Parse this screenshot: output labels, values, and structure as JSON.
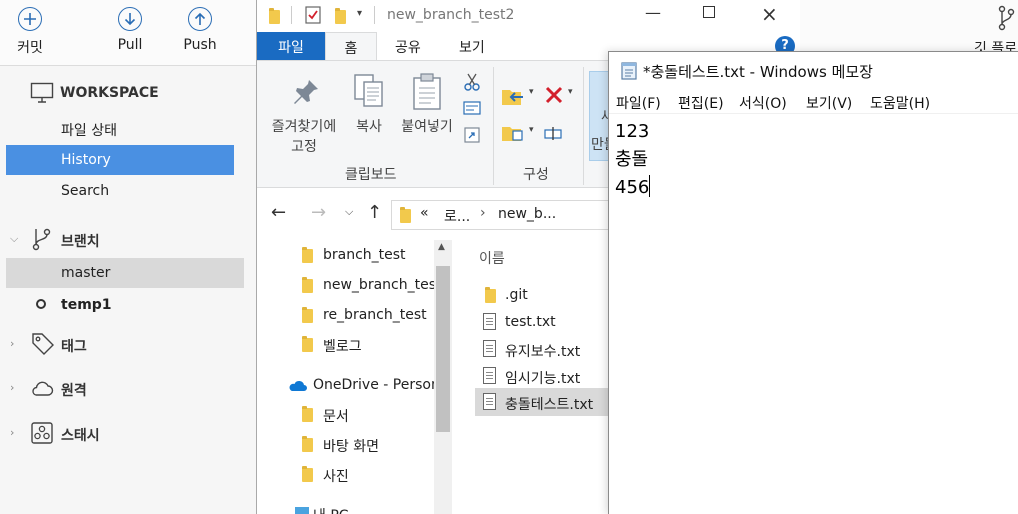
{
  "sourcetree": {
    "toolbar": {
      "commit": "커밋",
      "pull": "Pull",
      "push": "Push",
      "git_flow": "깃 플로"
    },
    "sidebar": {
      "workspace": "WORKSPACE",
      "file_status": "파일 상태",
      "history": "History",
      "search": "Search",
      "branches": "브랜치",
      "branch_master": "master",
      "branch_temp1": "temp1",
      "tags": "태그",
      "remotes": "원격",
      "stashes": "스태시"
    },
    "colors": {
      "selection": "#4a90e2",
      "icon_blue": "#2a6db5"
    }
  },
  "explorer": {
    "title": "new_branch_test2",
    "tabs": {
      "file": "파일",
      "home": "홈",
      "share": "공유",
      "view": "보기"
    },
    "ribbon": {
      "pin_quick_access_1": "즐겨찾기에",
      "pin_quick_access_2": "고정",
      "copy": "복사",
      "paste": "붙여넣기",
      "group_clipboard": "클립보드",
      "group_organize": "구성",
      "new_fragment_1": "새",
      "new_fragment_2": "만들"
    },
    "address": {
      "chevrons": "«",
      "part1": "로...",
      "part2": "new_b..."
    },
    "nav_pane": {
      "items": [
        "branch_test",
        "new_branch_test",
        "re_branch_test",
        "벨로그",
        "OneDrive - Person",
        "문서",
        "바탕 화면",
        "사진",
        "내 PC"
      ]
    },
    "list": {
      "column_name": "이름",
      "files": [
        ".git",
        "test.txt",
        "유지보수.txt",
        "임시기능.txt",
        "충돌테스트.txt"
      ]
    },
    "colors": {
      "file_tab": "#1a6bc2",
      "folder": "#f2c94c",
      "onedrive": "#0f78d4",
      "delete": "#d3202c"
    }
  },
  "notepad": {
    "title": "*충돌테스트.txt - Windows 메모장",
    "menu": [
      "파일(F)",
      "편집(E)",
      "서식(O)",
      "보기(V)",
      "도움말(H)"
    ],
    "lines": [
      "123",
      "충돌",
      "456"
    ]
  }
}
